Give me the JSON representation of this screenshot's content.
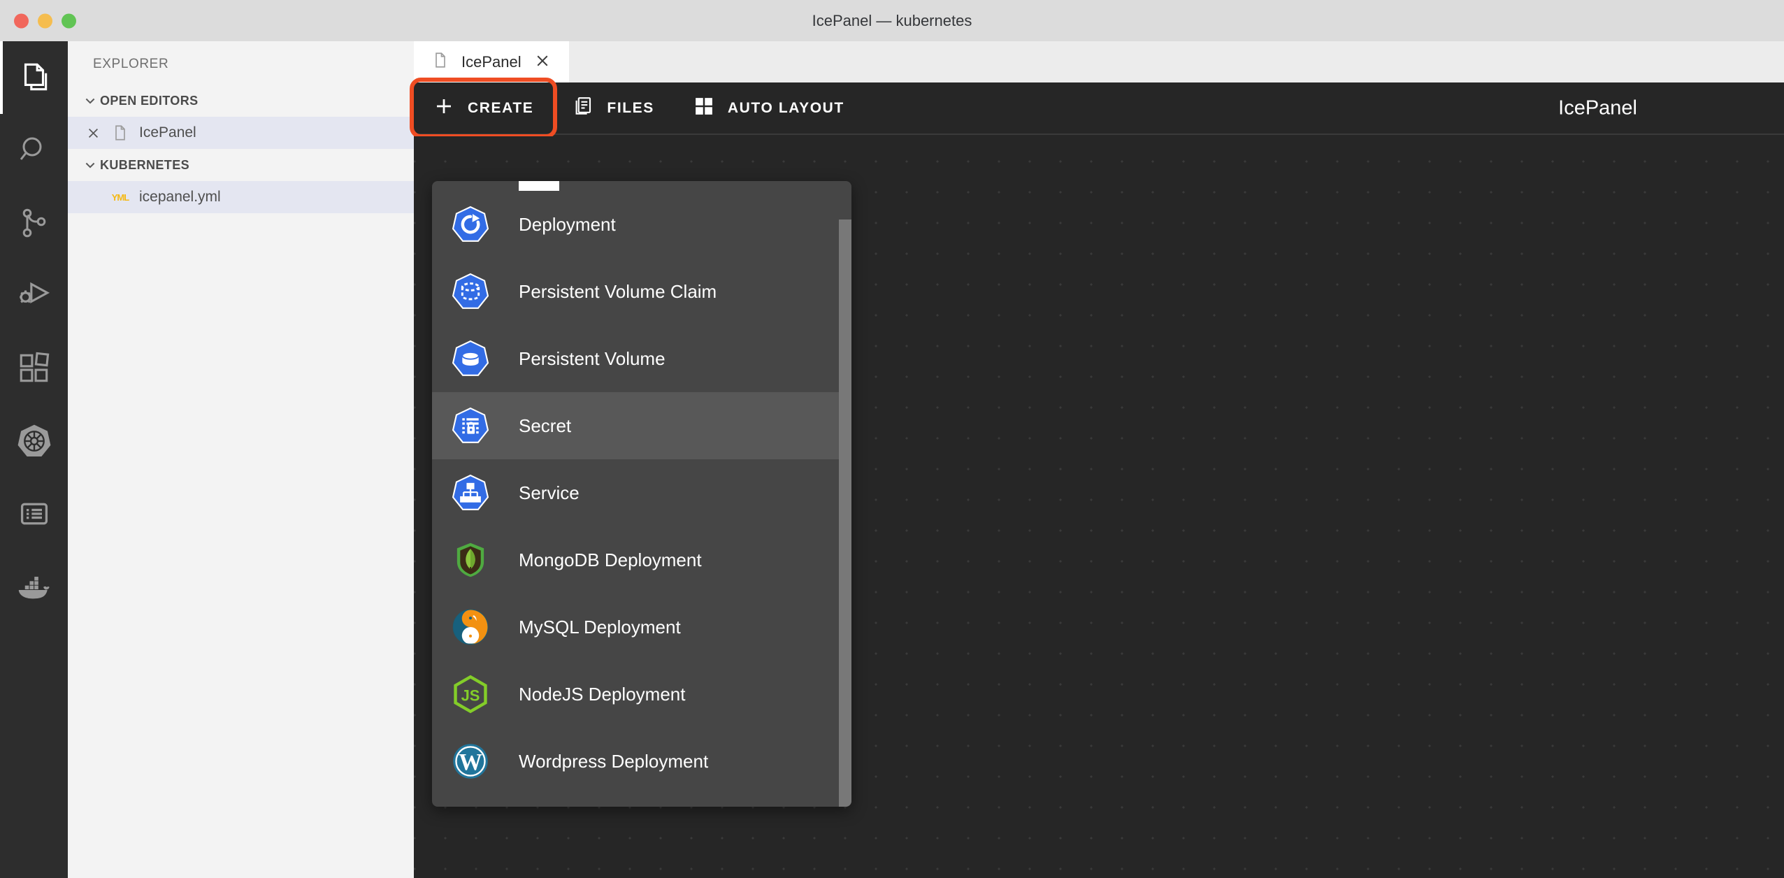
{
  "window": {
    "title": "IcePanel — kubernetes",
    "traffic_lights": [
      "close",
      "minimize",
      "zoom"
    ]
  },
  "activity_bar": {
    "items": [
      {
        "name": "explorer",
        "icon": "files-icon",
        "active": true
      },
      {
        "name": "search",
        "icon": "search-icon",
        "active": false
      },
      {
        "name": "source-control",
        "icon": "source-control-icon",
        "active": false
      },
      {
        "name": "run-and-debug",
        "icon": "run-debug-icon",
        "active": false
      },
      {
        "name": "extensions",
        "icon": "extensions-icon",
        "active": false
      },
      {
        "name": "kubernetes",
        "icon": "kubernetes-helm-icon",
        "active": false
      },
      {
        "name": "output-list",
        "icon": "list-icon",
        "active": false
      },
      {
        "name": "docker",
        "icon": "docker-whale-icon",
        "active": false
      }
    ]
  },
  "sidebar": {
    "title": "EXPLORER",
    "sections": [
      {
        "label": "OPEN EDITORS",
        "expanded": true,
        "rows": [
          {
            "label": "IcePanel",
            "icon": "file-icon",
            "has_close": true,
            "selected": true
          }
        ]
      },
      {
        "label": "KUBERNETES",
        "expanded": true,
        "rows": [
          {
            "label": "icepanel.yml",
            "icon": "yml-icon",
            "icon_text": "YML",
            "has_close": false,
            "selected": true
          }
        ]
      }
    ]
  },
  "editor": {
    "tabs": [
      {
        "label": "IcePanel",
        "icon": "file-icon",
        "active": true,
        "close_label": "✕"
      }
    ]
  },
  "app": {
    "name": "IcePanel",
    "toolbar": {
      "buttons": [
        {
          "label": "CREATE",
          "icon": "plus-icon",
          "highlighted": true
        },
        {
          "label": "FILES",
          "icon": "files-doc-icon",
          "highlighted": false
        },
        {
          "label": "AUTO LAYOUT",
          "icon": "grid-icon",
          "highlighted": false
        }
      ]
    },
    "create_menu": {
      "scrolled": true,
      "items": [
        {
          "label": "Deployment",
          "icon": "k8s-deployment-icon",
          "hovered": false
        },
        {
          "label": "Persistent Volume Claim",
          "icon": "k8s-pvc-icon",
          "hovered": false
        },
        {
          "label": "Persistent Volume",
          "icon": "k8s-pv-icon",
          "hovered": false
        },
        {
          "label": "Secret",
          "icon": "k8s-secret-icon",
          "hovered": true
        },
        {
          "label": "Service",
          "icon": "k8s-service-icon",
          "hovered": false
        },
        {
          "label": "MongoDB Deployment",
          "icon": "mongodb-icon",
          "hovered": false
        },
        {
          "label": "MySQL Deployment",
          "icon": "mysql-icon",
          "hovered": false
        },
        {
          "label": "NodeJS Deployment",
          "icon": "nodejs-icon",
          "hovered": false
        },
        {
          "label": "Wordpress Deployment",
          "icon": "wordpress-icon",
          "hovered": false
        }
      ]
    }
  },
  "colors": {
    "accent_highlight": "#ef4d23",
    "kubernetes_blue": "#326ce5",
    "mongodb_green": "#4faa41",
    "mysql_orange": "#f29111",
    "nodejs_green": "#83cd29",
    "wordpress_blue": "#21759b",
    "yml_yellow": "#f5b914",
    "canvas_bg": "#262626",
    "menu_bg": "#464646"
  }
}
